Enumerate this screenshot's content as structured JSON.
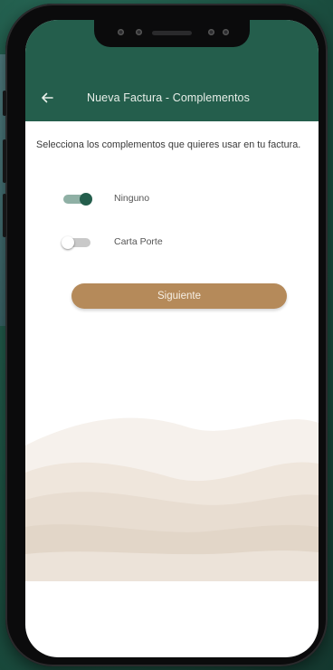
{
  "header": {
    "title": "Nueva Factura - Complementos",
    "back_icon": "arrow-left-icon"
  },
  "form": {
    "instructions": "Selecciona los complementos que quieres usar en tu factura.",
    "options": [
      {
        "label": "Ninguno",
        "checked": true
      },
      {
        "label": "Carta Porte",
        "checked": false
      }
    ],
    "next_label": "Siguiente"
  },
  "colors": {
    "primary": "#245e4c",
    "accent": "#b58a5a"
  }
}
